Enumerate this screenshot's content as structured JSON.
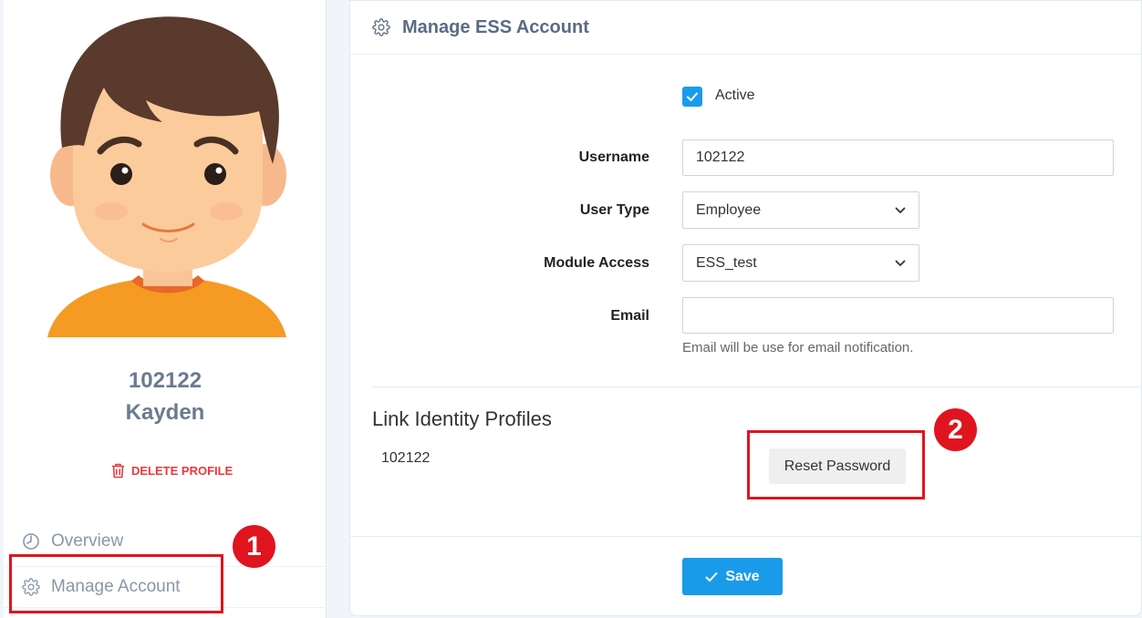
{
  "profile": {
    "employee_id": "102122",
    "name": "Kayden",
    "delete_label": "DELETE PROFILE"
  },
  "nav": {
    "items": [
      {
        "label": "Overview",
        "icon": "clock-history-icon"
      },
      {
        "label": "Manage Account",
        "icon": "gear-icon"
      }
    ]
  },
  "card": {
    "title": "Manage ESS Account",
    "active": {
      "label": "Active",
      "checked": true
    },
    "username": {
      "label": "Username",
      "value": "102122"
    },
    "user_type": {
      "label": "User Type",
      "value": "Employee"
    },
    "module_access": {
      "label": "Module Access",
      "value": "ESS_test"
    },
    "email": {
      "label": "Email",
      "value": "",
      "help": "Email will be use for email notification."
    },
    "link_section": {
      "title": "Link Identity Profiles",
      "linked_id": "102122",
      "reset_label": "Reset Password"
    },
    "save_label": "Save"
  },
  "annotations": [
    "1",
    "2"
  ],
  "colors": {
    "accent": "#1a9bea",
    "annotation": "#e0141e",
    "danger": "#e8383f",
    "muted_text": "#6b7a90"
  }
}
